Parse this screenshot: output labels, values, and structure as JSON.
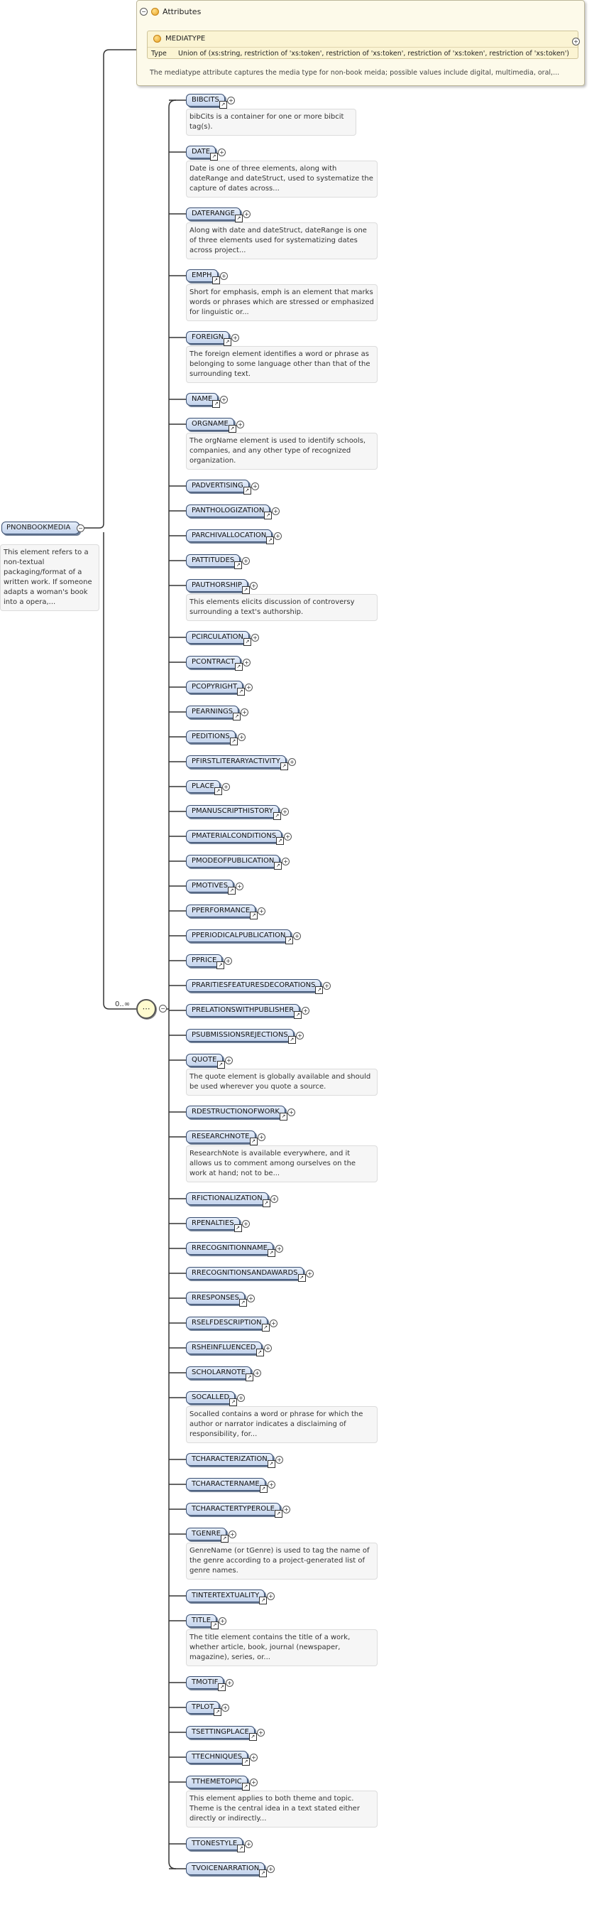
{
  "root": {
    "name": "PNONBOOKMEDIA",
    "doc": "This element refers to a non-textual packaging/format of a written work. If someone adapts a woman's book into a opera,..."
  },
  "attributes": {
    "header": "Attributes",
    "name": "MEDIATYPE",
    "type_label": "Type",
    "type_value": "Union of (xs:string, restriction of 'xs:token', restriction of 'xs:token', restriction of 'xs:token', restriction of 'xs:token')",
    "doc": "The mediatype attribute captures the media type for non-book meida; possible values include digital, multimedia, oral,..."
  },
  "sequence": {
    "cardinality": "0..∞",
    "icon": "sequence-compositor-icon"
  },
  "elements": [
    {
      "name": "BIBCITS",
      "doc": "bibCits is a container for one or more bibcit tag(s)."
    },
    {
      "name": "DATE",
      "doc": "Date is one of three elements, along with dateRange and dateStruct, used to systematize the capture of dates across..."
    },
    {
      "name": "DATERANGE",
      "doc": "Along with date and dateStruct, dateRange is one of three elements used for systematizing dates across project..."
    },
    {
      "name": "EMPH",
      "doc": "Short for emphasis, emph is an element that marks words or phrases which are stressed or emphasized for linguistic or..."
    },
    {
      "name": "FOREIGN",
      "doc": "The foreign element identifies a word or phrase as belonging to some language other than that of the surrounding text."
    },
    {
      "name": "NAME"
    },
    {
      "name": "ORGNAME",
      "doc": "The orgName element is used to identify schools, companies, and any other type of recognized organization."
    },
    {
      "name": "PADVERTISING"
    },
    {
      "name": "PANTHOLOGIZATION"
    },
    {
      "name": "PARCHIVALLOCATION"
    },
    {
      "name": "PATTITUDES"
    },
    {
      "name": "PAUTHORSHIP",
      "doc": "This elements elicits discussion of controversy surrounding a text's authorship."
    },
    {
      "name": "PCIRCULATION"
    },
    {
      "name": "PCONTRACT"
    },
    {
      "name": "PCOPYRIGHT"
    },
    {
      "name": "PEARNINGS"
    },
    {
      "name": "PEDITIONS"
    },
    {
      "name": "PFIRSTLITERARYACTIVITY"
    },
    {
      "name": "PLACE"
    },
    {
      "name": "PMANUSCRIPTHISTORY"
    },
    {
      "name": "PMATERIALCONDITIONS"
    },
    {
      "name": "PMODEOFPUBLICATION"
    },
    {
      "name": "PMOTIVES"
    },
    {
      "name": "PPERFORMANCE"
    },
    {
      "name": "PPERIODICALPUBLICATION"
    },
    {
      "name": "PPRICE"
    },
    {
      "name": "PRARITIESFEATURESDECORATIONS"
    },
    {
      "name": "PRELATIONSWITHPUBLISHER"
    },
    {
      "name": "PSUBMISSIONSREJECTIONS"
    },
    {
      "name": "QUOTE",
      "doc": "The quote element is globally available and should be used wherever you quote a source."
    },
    {
      "name": "RDESTRUCTIONOFWORK"
    },
    {
      "name": "RESEARCHNOTE",
      "doc": "ResearchNote is available everywhere, and it allows us to comment among ourselves on the work at hand; not to be..."
    },
    {
      "name": "RFICTIONALIZATION"
    },
    {
      "name": "RPENALTIES"
    },
    {
      "name": "RRECOGNITIONNAME"
    },
    {
      "name": "RRECOGNITIONSANDAWARDS"
    },
    {
      "name": "RRESPONSES"
    },
    {
      "name": "RSELFDESCRIPTION"
    },
    {
      "name": "RSHEINFLUENCED"
    },
    {
      "name": "SCHOLARNOTE"
    },
    {
      "name": "SOCALLED",
      "doc": "Socalled contains a word or phrase for which the author or narrator indicates a disclaiming of responsibility, for..."
    },
    {
      "name": "TCHARACTERIZATION"
    },
    {
      "name": "TCHARACTERNAME"
    },
    {
      "name": "TCHARACTERTYPEROLE"
    },
    {
      "name": "TGENRE",
      "doc": "GenreName (or tGenre) is used to tag the name of the genre according to a project-generated list of genre names."
    },
    {
      "name": "TINTERTEXTUALITY"
    },
    {
      "name": "TITLE",
      "doc": "The title element contains the title of a work, whether article, book, journal (newspaper, magazine), series, or..."
    },
    {
      "name": "TMOTIF"
    },
    {
      "name": "TPLOT"
    },
    {
      "name": "TSETTINGPLACE"
    },
    {
      "name": "TTECHNIQUES"
    },
    {
      "name": "TTHEMETOPIC",
      "doc": "This element applies to both theme and topic. Theme is the central idea in a text stated either directly or indirectly..."
    },
    {
      "name": "TTONESTYLE"
    },
    {
      "name": "TVOICENARRATION"
    }
  ]
}
